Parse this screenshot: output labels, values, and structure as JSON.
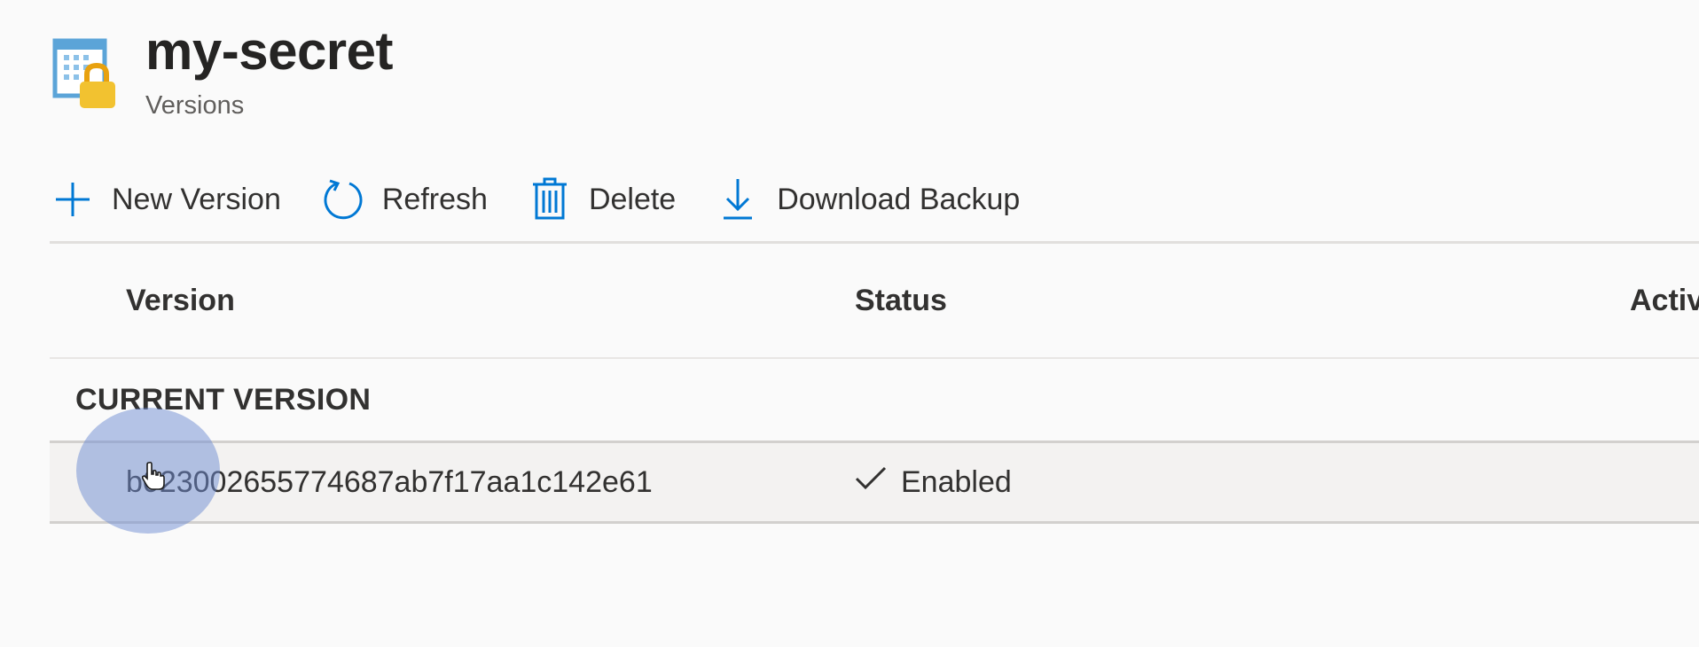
{
  "header": {
    "title": "my-secret",
    "subtitle": "Versions",
    "icon": "key-vault-secret-icon"
  },
  "toolbar": {
    "new_version_label": "New Version",
    "refresh_label": "Refresh",
    "delete_label": "Delete",
    "download_backup_label": "Download Backup"
  },
  "table": {
    "columns": [
      "Version",
      "Status",
      "Activ"
    ],
    "group_label": "CURRENT VERSION",
    "rows": [
      {
        "version": "b023002655774687ab7f17aa1c142e61",
        "status": "Enabled"
      }
    ]
  },
  "colors": {
    "accent": "#0078d4",
    "lock": "#f2c230",
    "row_background": "#f3f2f1"
  }
}
